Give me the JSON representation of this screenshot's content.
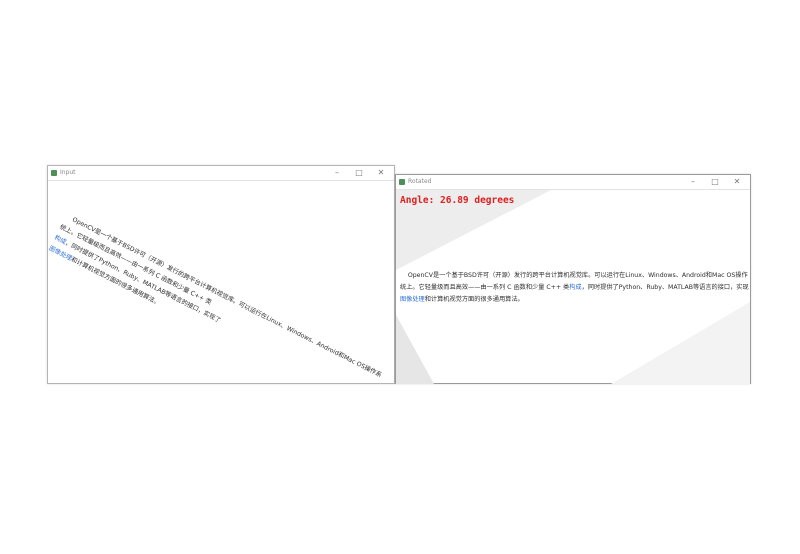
{
  "input_window": {
    "title": "Input",
    "controls": {
      "minimize": "–",
      "maximize": "□",
      "close": "✕"
    },
    "text": {
      "line1": "    OpenCV是一个基于BSD许可（开源）发行的跨平台计算机视觉库。可以运行在Linux、Windows、Android和Mac OS操作系",
      "line2a": "统上。它轻量级而且高效——由一系列 C 函数和少量 C++ 类",
      "line2b": "构成",
      "line2c": "，同时提供了Python、Ruby、MATLAB等语言的接口，实现了",
      "line3a": "图像处理",
      "line3b": "和计算机视觉方面的很多通用算法。"
    }
  },
  "rotated_window": {
    "title": "Rotated",
    "controls": {
      "minimize": "–",
      "maximize": "□",
      "close": "✕"
    },
    "angle_label": "Angle: 26.89 degrees",
    "text": {
      "line1": "    OpenCV是一个基于BSD许可（开源）发行的跨平台计算机视觉库。可以运行在Linux、Windows、Android和Mac OS操作",
      "line2a": "统上。它轻量级而且高效——由一系列 C 函数和少量 C++ 类",
      "line2b": "构成",
      "line2c": "，同时提供了Python、Ruby、MATLAB等语言的接口，实现",
      "line3a": "图像处理",
      "line3b": "和计算机视觉方面的很多通用算法。"
    }
  },
  "colors": {
    "angle_text": "#e01e1e",
    "link_text": "#2a6fd8",
    "body_text": "#2d2d2d"
  }
}
